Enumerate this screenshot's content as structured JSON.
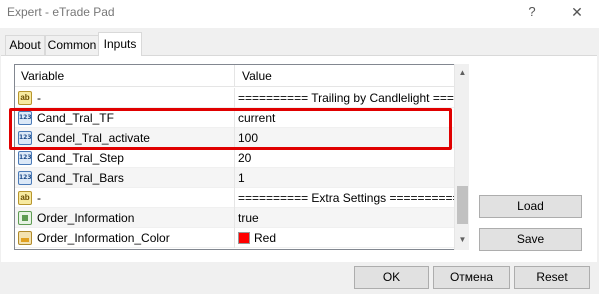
{
  "window": {
    "title": "Expert - eTrade Pad",
    "help_label": "?",
    "close_label": "✕"
  },
  "tabs": [
    {
      "label": "About"
    },
    {
      "label": "Common"
    },
    {
      "label": "Inputs"
    }
  ],
  "grid": {
    "columns": {
      "variable": "Variable",
      "value": "Value"
    },
    "rows": [
      {
        "icon": "string-type-icon",
        "name": "-",
        "value": "========== Trailing by Candlelight ======="
      },
      {
        "icon": "integer-type-icon",
        "name": "Cand_Tral_TF",
        "value": "current"
      },
      {
        "icon": "integer-type-icon",
        "name": "Candel_Tral_activate",
        "value": "100"
      },
      {
        "icon": "integer-type-icon",
        "name": "Cand_Tral_Step",
        "value": "20"
      },
      {
        "icon": "integer-type-icon",
        "name": "Cand_Tral_Bars",
        "value": "1"
      },
      {
        "icon": "string-type-icon",
        "name": "-",
        "value": "========== Extra Settings =========="
      },
      {
        "icon": "boolean-type-icon",
        "name": "Order_Information",
        "value": "true"
      },
      {
        "icon": "color-type-icon",
        "name": "Order_Information_Color",
        "value": "Red",
        "swatch": "#ff0000"
      }
    ]
  },
  "icons": {
    "integer_glyph": "123",
    "string_glyph": "ab"
  },
  "buttons": {
    "load": "Load",
    "save": "Save",
    "ok": "OK",
    "cancel": "Отмена",
    "reset": "Reset"
  },
  "colors": {
    "highlight": "#e00000",
    "swatch_red": "#ff0000"
  }
}
